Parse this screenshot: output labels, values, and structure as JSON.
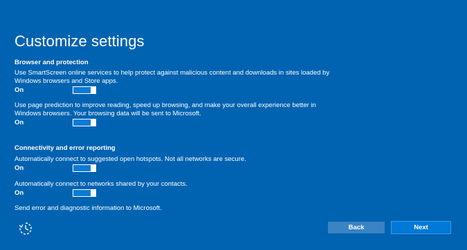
{
  "page": {
    "title": "Customize settings"
  },
  "sections": {
    "browser": {
      "heading": "Browser and protection",
      "smartscreen_desc": "Use SmartScreen online services to help protect against malicious content and downloads in sites loaded by Windows browsers and Store apps.",
      "smartscreen_state": "On",
      "prediction_desc": "Use page prediction to improve reading, speed up browsing, and make your overall experience better in Windows browsers. Your browsing data will be sent to Microsoft.",
      "prediction_state": "On"
    },
    "connectivity": {
      "heading": "Connectivity and error reporting",
      "hotspots_desc": "Automatically connect to suggested open hotspots. Not all networks are secure.",
      "hotspots_state": "On",
      "contacts_desc": "Automatically connect to networks shared by your contacts.",
      "contacts_state": "On",
      "error_desc": "Send error and diagnostic information to Microsoft."
    }
  },
  "footer": {
    "ease_icon": "ease-of-access-icon",
    "back_label": "Back",
    "next_label": "Next"
  },
  "colors": {
    "background": "#0063b1",
    "toggle_fill": "#0a7bd6",
    "back_button": "#3a83c4",
    "next_button": "#0078d7"
  }
}
